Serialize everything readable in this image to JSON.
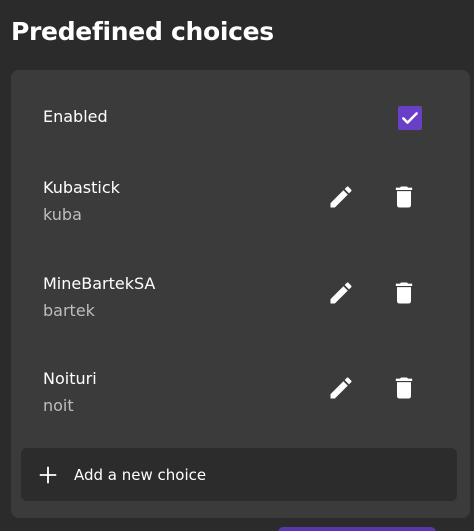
{
  "header": {
    "title": "Predefined choices"
  },
  "enabled": {
    "label": "Enabled",
    "checked": true,
    "accent_color": "#6a3fc8"
  },
  "choices": [
    {
      "name": "Kubastick",
      "value": "kuba"
    },
    {
      "name": "MineBartekSA",
      "value": "bartek"
    },
    {
      "name": "Noituri",
      "value": "noit"
    }
  ],
  "icons": {
    "edit": "pencil-icon",
    "delete": "trash-icon",
    "add": "plus-icon",
    "check": "check-icon"
  },
  "add_choice": {
    "label": "Add a new choice"
  }
}
